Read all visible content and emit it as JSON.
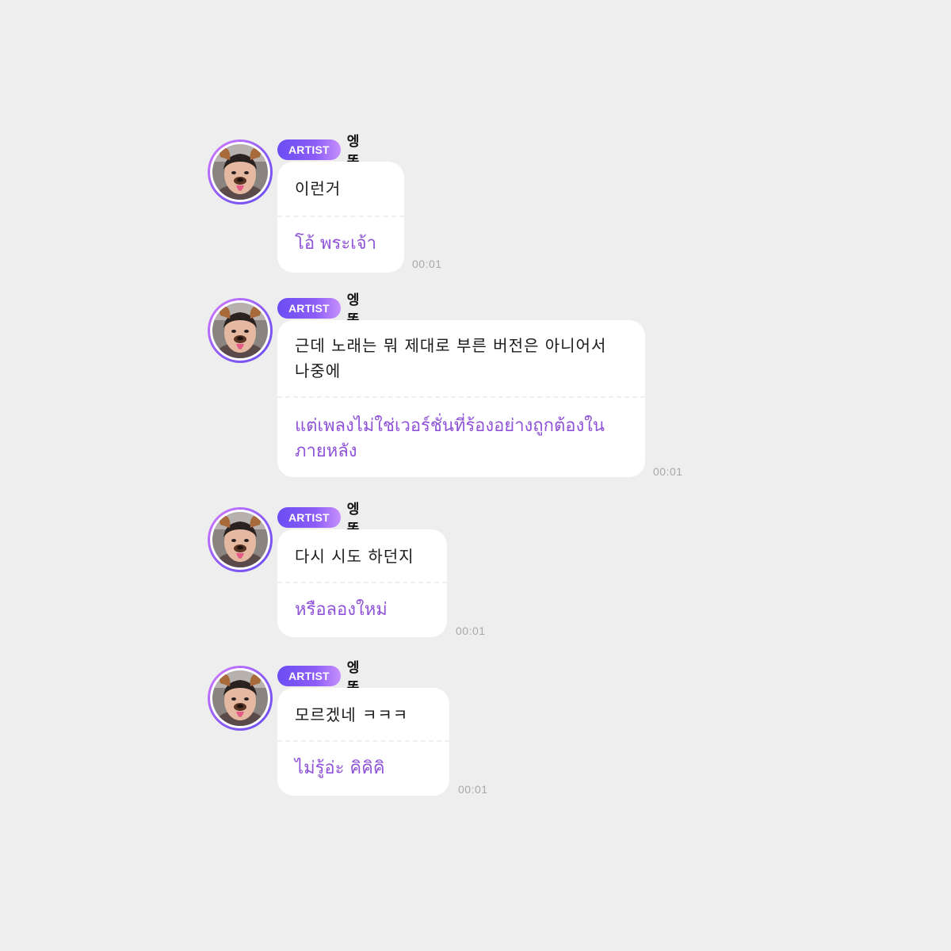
{
  "messages": [
    {
      "badge": "ARTIST",
      "name": "엥똔",
      "original": "이런거",
      "translation": "โอ้ พระเจ้า",
      "time": "00:01"
    },
    {
      "badge": "ARTIST",
      "name": "엥똔",
      "original": "근데 노래는 뭐 제대로 부른 버전은 아니어서 나중에",
      "translation": "แต่เพลงไม่ใช่เวอร์ชั่นที่ร้องอย่างถูกต้องในภายหลัง",
      "time": "00:01"
    },
    {
      "badge": "ARTIST",
      "name": "엥똔",
      "original": "다시 시도 하던지",
      "translation": "หรือลองใหม่",
      "time": "00:01"
    },
    {
      "badge": "ARTIST",
      "name": "엥똔",
      "original": "모르겠네 ㅋㅋㅋ",
      "translation": "ไม่รู้อ่ะ คิคิคิ",
      "time": "00:01"
    }
  ],
  "colors": {
    "background": "#eeeeee",
    "badge_start": "#6a4cf3",
    "badge_end": "#c790ff",
    "translation_text": "#8f53d8",
    "time_text": "#a9a9a9"
  },
  "icons": {
    "avatar": "dog-filter-avatar-icon"
  }
}
